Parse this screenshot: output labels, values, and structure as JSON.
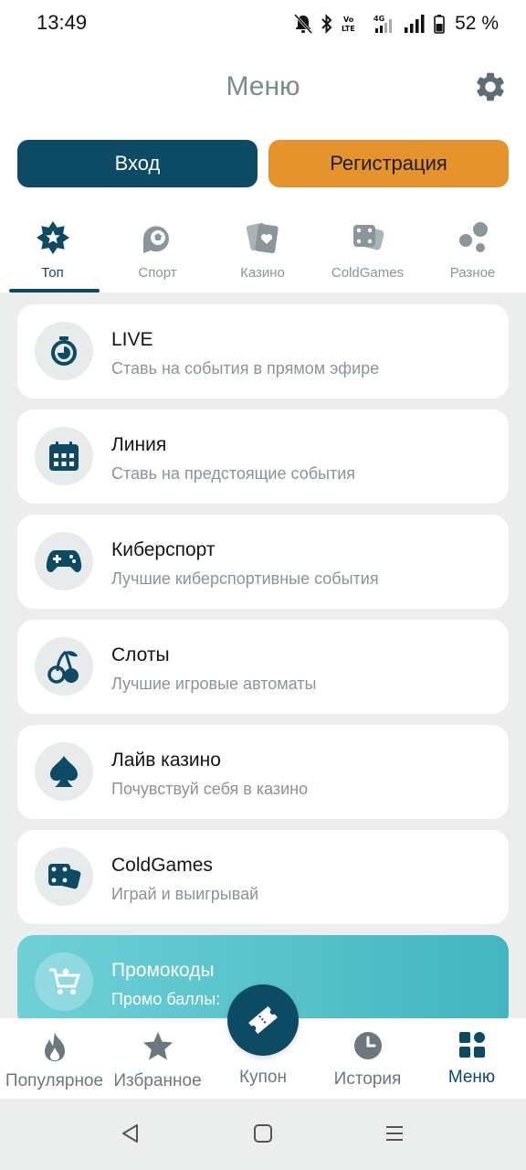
{
  "status_bar": {
    "time": "13:49",
    "battery": "52 %",
    "icons": [
      "bell-off-icon",
      "bluetooth-icon",
      "volte-icon",
      "4g-signal-icon",
      "signal-icon",
      "battery-icon"
    ]
  },
  "header": {
    "title": "Меню",
    "settings_icon": "gear-icon"
  },
  "auth": {
    "login_label": "Вход",
    "register_label": "Регистрация"
  },
  "tabs": [
    {
      "label": "Топ",
      "icon": "star-badge-icon",
      "active": true
    },
    {
      "label": "Спорт",
      "icon": "soccer-ball-icon",
      "active": false
    },
    {
      "label": "Казино",
      "icon": "playing-cards-icon",
      "active": false
    },
    {
      "label": "ColdGames",
      "icon": "dice-icon",
      "active": false
    },
    {
      "label": "Разное",
      "icon": "bubbles-icon",
      "active": false
    }
  ],
  "menu_items": [
    {
      "title": "LIVE",
      "subtitle": "Ставь на события в прямом эфире",
      "icon": "stopwatch-icon"
    },
    {
      "title": "Линия",
      "subtitle": "Ставь на предстоящие события",
      "icon": "calendar-icon"
    },
    {
      "title": "Киберспорт",
      "subtitle": "Лучшие киберспортивные события",
      "icon": "gamepad-icon"
    },
    {
      "title": "Слоты",
      "subtitle": "Лучшие игровые автоматы",
      "icon": "cherry-icon"
    },
    {
      "title": "Лайв казино",
      "subtitle": "Почувствуй себя в казино",
      "icon": "spade-icon"
    },
    {
      "title": "ColdGames",
      "subtitle": "Играй и выигрывай",
      "icon": "dice-icon"
    },
    {
      "title": "Промокоды",
      "subtitle": "Промо баллы: ",
      "icon": "cart-icon"
    }
  ],
  "bottom_nav": {
    "items": [
      {
        "label": "Популярное",
        "icon": "flame-icon"
      },
      {
        "label": "Избранное",
        "icon": "star-icon"
      },
      {
        "label": "История",
        "icon": "clock-icon"
      },
      {
        "label": "Меню",
        "icon": "grid-menu-icon",
        "active": true
      }
    ],
    "coupon_label": "Купон",
    "coupon_icon": "ticket-icon"
  },
  "colors": {
    "primary": "#0d4a63",
    "accent": "#e5932d",
    "promo": "#43b6bf",
    "muted": "#8a969b"
  }
}
